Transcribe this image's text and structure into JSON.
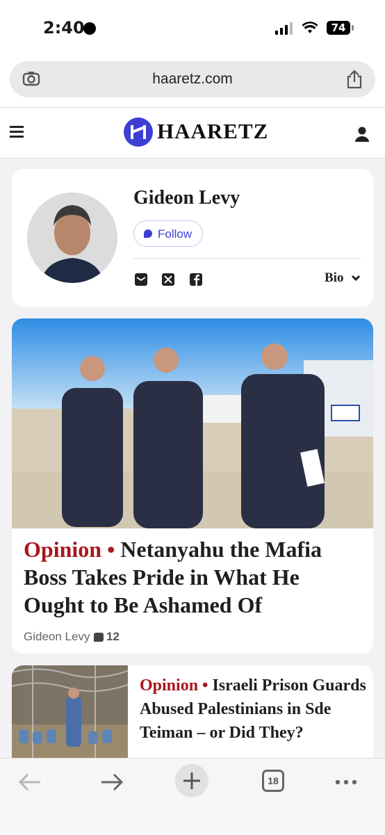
{
  "status_bar": {
    "time": "2:40",
    "battery": "74"
  },
  "browser": {
    "url": "haaretz.com",
    "tab_count": "18"
  },
  "site": {
    "logo_text": "HAARETZ",
    "logo_color": "#3d3fd4"
  },
  "author": {
    "name": "Gideon Levy",
    "follow_label": "Follow",
    "bio_label": "Bio",
    "social_icons": [
      "email-icon",
      "x-icon",
      "facebook-icon"
    ]
  },
  "articles": [
    {
      "kicker": "Opinion",
      "separator": "•",
      "title": "Netanyahu the Mafia Boss Takes Pride in What He Ought to Be Ashamed Of",
      "author": "Gideon Levy",
      "comments": "12"
    },
    {
      "kicker": "Opinion",
      "separator": "•",
      "title": "Israeli Prison Guards Abused Palestinians in Sde Teiman – or Did They?"
    }
  ],
  "colors": {
    "kicker": "#a8171f",
    "accent": "#3d3fd4"
  }
}
